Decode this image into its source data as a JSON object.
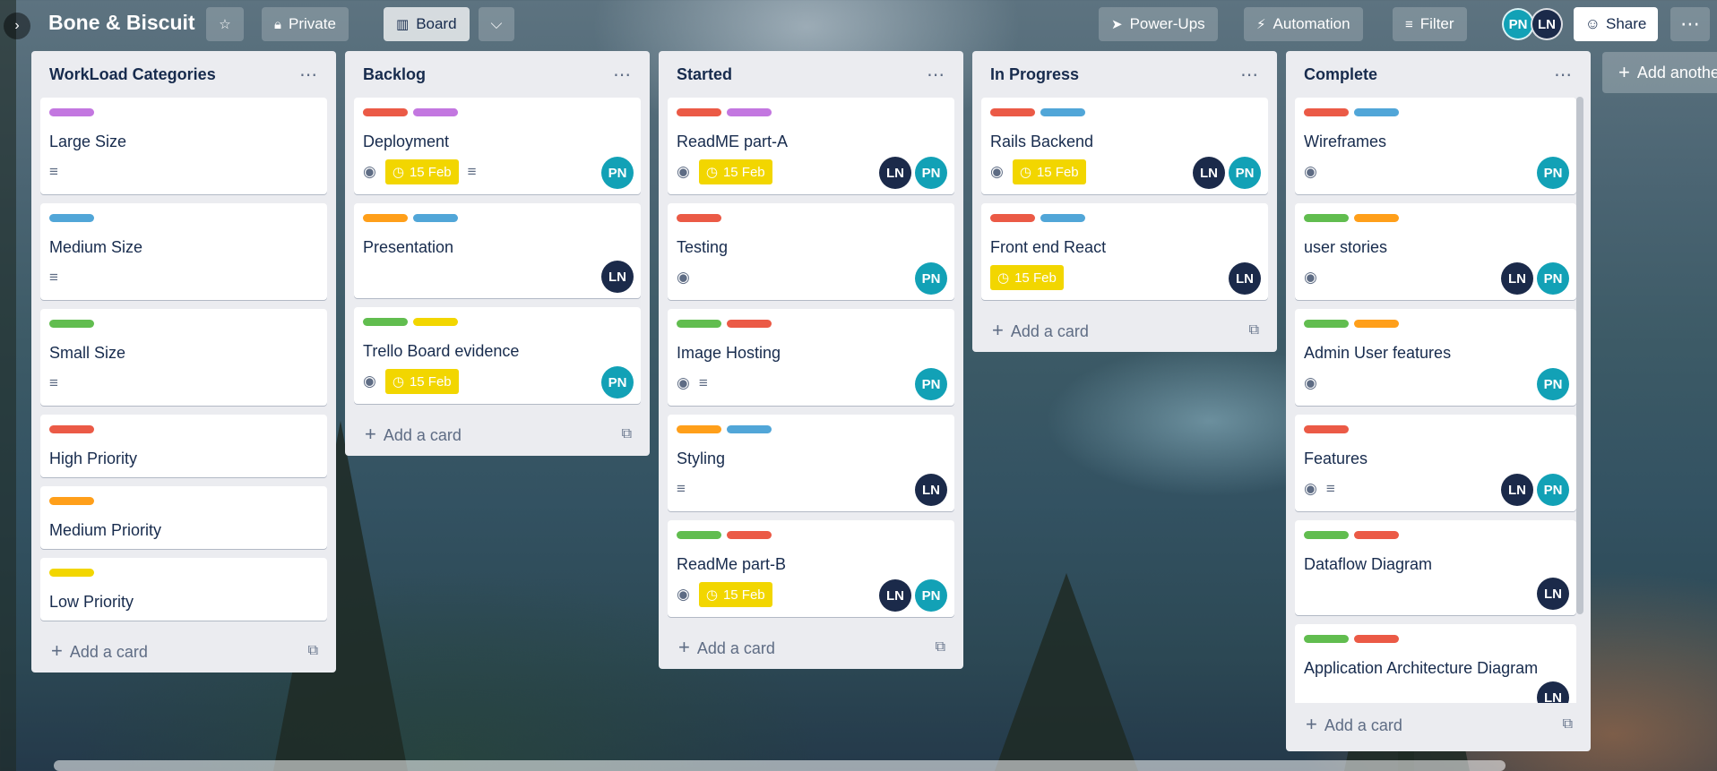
{
  "board": {
    "title": "Bone & Biscuit",
    "expander_icon": "chevron-right-icon",
    "visibility_label": "Private",
    "view_label": "Board",
    "powerups_label": "Power-Ups",
    "automation_label": "Automation",
    "filter_label": "Filter",
    "share_label": "Share",
    "add_list_label": "Add another list",
    "members": [
      "PN",
      "LN"
    ]
  },
  "colors": {
    "green": "#61bd4f",
    "yellow": "#f2d600",
    "orange": "#ff9f1a",
    "red": "#eb5a46",
    "purple": "#c377e0",
    "blue": "#0079bf",
    "sky": "#51a6d8",
    "pn_avatar": "#12a1b6",
    "ln_avatar": "#1b2a4a"
  },
  "lists": [
    {
      "title": "WorkLoad Categories",
      "add_card": "Add a card",
      "cards": [
        {
          "title": "Large Size",
          "labels": [
            "#c377e0"
          ],
          "desc": true
        },
        {
          "title": "Medium Size",
          "labels": [
            "#51a6d8"
          ],
          "desc": true
        },
        {
          "title": "Small Size",
          "labels": [
            "#61bd4f"
          ],
          "desc": true
        },
        {
          "title": "High Priority",
          "labels": [
            "#eb5a46"
          ]
        },
        {
          "title": "Medium Priority",
          "labels": [
            "#ff9f1a"
          ]
        },
        {
          "title": "Low Priority",
          "labels": [
            "#f2d600"
          ]
        }
      ]
    },
    {
      "title": "Backlog",
      "add_card": "Add a card",
      "cards": [
        {
          "title": "Deployment",
          "labels": [
            "#eb5a46",
            "#c377e0"
          ],
          "watch": true,
          "due": "15 Feb",
          "desc": true,
          "members": [
            "PN"
          ]
        },
        {
          "title": "Presentation",
          "labels": [
            "#ff9f1a",
            "#51a6d8"
          ],
          "members": [
            "LN"
          ]
        },
        {
          "title": "Trello Board evidence",
          "labels": [
            "#61bd4f",
            "#f2d600"
          ],
          "watch": true,
          "due": "15 Feb",
          "members": [
            "PN"
          ]
        }
      ]
    },
    {
      "title": "Started",
      "add_card": "Add a card",
      "cards": [
        {
          "title": "ReadME part-A",
          "labels": [
            "#eb5a46",
            "#c377e0"
          ],
          "watch": true,
          "due": "15 Feb",
          "members": [
            "LN",
            "PN"
          ]
        },
        {
          "title": "Testing",
          "labels": [
            "#eb5a46"
          ],
          "watch": true,
          "members": [
            "PN"
          ]
        },
        {
          "title": "Image Hosting",
          "labels": [
            "#61bd4f",
            "#eb5a46"
          ],
          "watch": true,
          "desc": true,
          "members": [
            "PN"
          ]
        },
        {
          "title": "Styling",
          "labels": [
            "#ff9f1a",
            "#51a6d8"
          ],
          "desc": true,
          "members": [
            "LN"
          ]
        },
        {
          "title": "ReadMe part-B",
          "labels": [
            "#61bd4f",
            "#eb5a46"
          ],
          "watch": true,
          "due": "15 Feb",
          "members": [
            "LN",
            "PN"
          ]
        }
      ]
    },
    {
      "title": "In Progress",
      "add_card": "Add a card",
      "cards": [
        {
          "title": "Rails Backend",
          "labels": [
            "#eb5a46",
            "#51a6d8"
          ],
          "watch": true,
          "due": "15 Feb",
          "members": [
            "LN",
            "PN"
          ]
        },
        {
          "title": "Front end React",
          "labels": [
            "#eb5a46",
            "#51a6d8"
          ],
          "due": "15 Feb",
          "members": [
            "LN"
          ]
        }
      ]
    },
    {
      "title": "Complete",
      "add_card": "Add a card",
      "cards": [
        {
          "title": "Wireframes",
          "labels": [
            "#eb5a46",
            "#51a6d8"
          ],
          "watch": true,
          "members": [
            "PN"
          ]
        },
        {
          "title": "user stories",
          "labels": [
            "#61bd4f",
            "#ff9f1a"
          ],
          "watch": true,
          "members": [
            "LN",
            "PN"
          ]
        },
        {
          "title": "Admin User features",
          "labels": [
            "#61bd4f",
            "#ff9f1a"
          ],
          "watch": true,
          "members": [
            "PN"
          ]
        },
        {
          "title": "Features",
          "labels": [
            "#eb5a46"
          ],
          "watch": true,
          "desc": true,
          "members": [
            "LN",
            "PN"
          ]
        },
        {
          "title": "Dataflow Diagram",
          "labels": [
            "#61bd4f",
            "#eb5a46"
          ],
          "members": [
            "LN"
          ]
        },
        {
          "title": "Application Architecture Diagram",
          "labels": [
            "#61bd4f",
            "#eb5a46"
          ],
          "members": [
            "LN"
          ]
        }
      ]
    }
  ]
}
